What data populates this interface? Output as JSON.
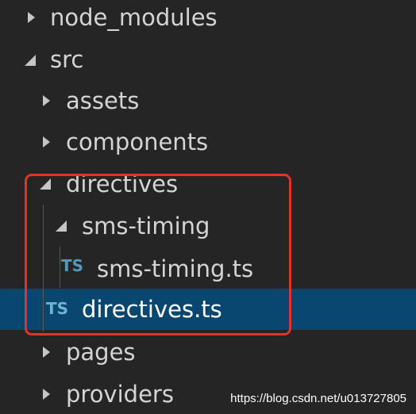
{
  "explorer": {
    "items": [
      {
        "label": "node_modules",
        "type": "folder",
        "state": "collapsed"
      },
      {
        "label": "src",
        "type": "folder",
        "state": "expanded"
      },
      {
        "label": "assets",
        "type": "folder",
        "state": "collapsed"
      },
      {
        "label": "components",
        "type": "folder",
        "state": "collapsed"
      },
      {
        "label": "directives",
        "type": "folder",
        "state": "expanded"
      },
      {
        "label": "sms-timing",
        "type": "folder",
        "state": "expanded"
      },
      {
        "label": "sms-timing.ts",
        "type": "file",
        "icon_text": "TS"
      },
      {
        "label": "directives.ts",
        "type": "file",
        "icon_text": "TS",
        "selected": true
      },
      {
        "label": "pages",
        "type": "folder",
        "state": "collapsed"
      },
      {
        "label": "providers",
        "type": "folder",
        "state": "collapsed"
      }
    ]
  },
  "watermark": "https://blog.csdn.net/u013727805",
  "colors": {
    "background": "#252526",
    "selection": "#094771",
    "ts_icon": "#519aba",
    "highlight_border": "#e0342a"
  }
}
